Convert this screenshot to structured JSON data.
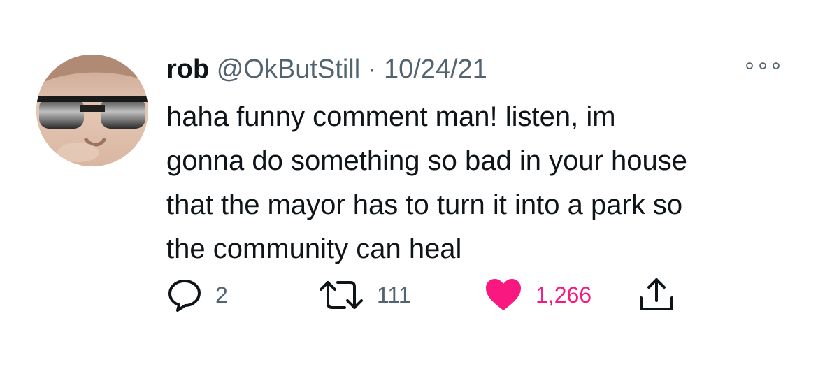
{
  "tweet": {
    "display_name": "rob",
    "handle": "@OkButStill",
    "separator": "·",
    "date": "10/24/21",
    "text_lines": [
      "haha funny comment man! listen, im",
      "gonna do something so bad in your house",
      "that the mayor has to turn it into a park so",
      "the community can heal"
    ],
    "more_icon": "more-dots-icon"
  },
  "actions": {
    "reply": {
      "icon": "reply-icon",
      "count": "2"
    },
    "retweet": {
      "icon": "retweet-icon",
      "count": "111"
    },
    "like": {
      "icon": "heart-icon",
      "count": "1,266",
      "liked": true
    },
    "share": {
      "icon": "share-icon"
    }
  },
  "colors": {
    "text": "#0f1419",
    "muted": "#536471",
    "like": "#f91880",
    "background": "#ffffff"
  }
}
